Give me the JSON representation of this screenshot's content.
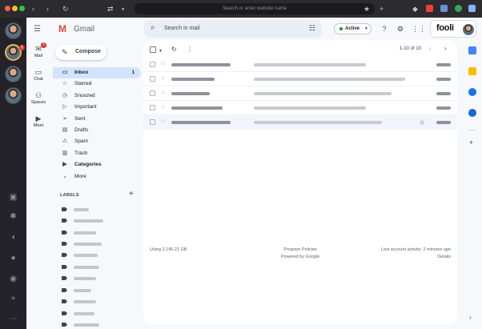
{
  "browser": {
    "url_placeholder": "Search or enter website name"
  },
  "rail": {
    "mail_label": "Mail",
    "mail_badge": "3",
    "chat_label": "Chat",
    "spaces_label": "Spaces",
    "meet_label": "Meet"
  },
  "gmail": {
    "logo_text": "Gmail",
    "compose_label": "Compose",
    "nav": [
      {
        "label": "Inbox",
        "count": "1"
      },
      {
        "label": "Starred"
      },
      {
        "label": "Snoozed"
      },
      {
        "label": "Important"
      },
      {
        "label": "Sent"
      },
      {
        "label": "Drafts"
      },
      {
        "label": "Spam"
      },
      {
        "label": "Trash"
      },
      {
        "label": "Categories"
      },
      {
        "label": "More"
      }
    ],
    "labels_header": "LABELS"
  },
  "topbar": {
    "search_placeholder": "Search in mail",
    "status_label": "Active",
    "account_name": "fooli"
  },
  "mail_list": {
    "pager": "1-10 of 10"
  },
  "footer": {
    "storage": "Using 2,145.21 GB",
    "policies": "Program Policies",
    "powered": "Powered by Google",
    "activity": "Last account activity: 2 minutes ago",
    "details": "Details"
  },
  "colors": {
    "accent_blue": "#d3e3fd",
    "active_green": "#1e8e3e",
    "badge_red": "#d93025"
  }
}
